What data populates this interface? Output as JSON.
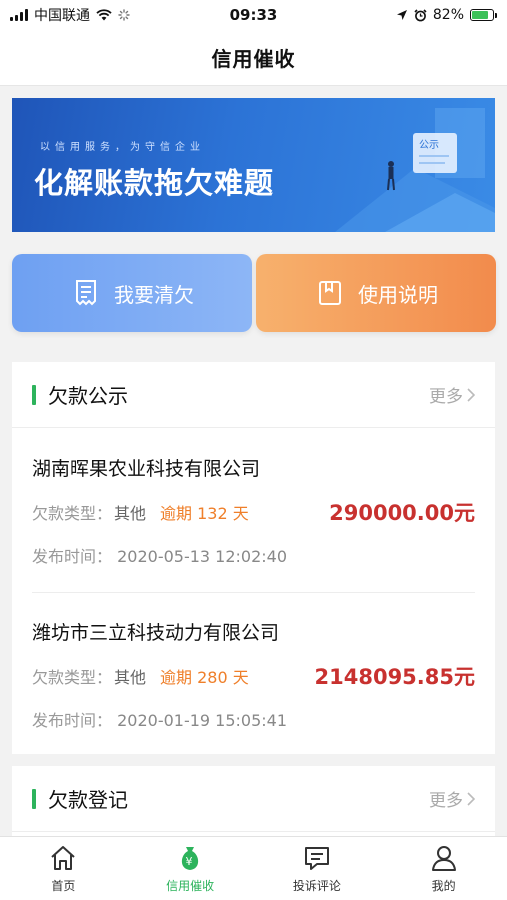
{
  "status_bar": {
    "carrier": "中国联通",
    "time": "09:33",
    "battery": "82%",
    "battery_level": 0.82
  },
  "nav": {
    "title": "信用催收"
  },
  "banner": {
    "subtitle": "以信用服务，为守信企业",
    "title": "化解账款拖欠难题",
    "sign_text": "公示"
  },
  "actions": {
    "clear_debt": "我要清欠",
    "guide": "使用说明"
  },
  "debt_notice": {
    "title": "欠款公示",
    "more": "更多",
    "items": [
      {
        "company": "湖南晖果农业科技有限公司",
        "type_label": "欠款类型：",
        "type": "其他",
        "overdue": "逾期 132 天",
        "amount": "290000.00元",
        "time_label": "发布时间：",
        "time": "2020-05-13 12:02:40"
      },
      {
        "company": "潍坊市三立科技动力有限公司",
        "type_label": "欠款类型：",
        "type": "其他",
        "overdue": "逾期 280 天",
        "amount": "2148095.85元",
        "time_label": "发布时间：",
        "time": "2020-01-19 15:05:41"
      }
    ]
  },
  "debt_register": {
    "title": "欠款登记",
    "more": "更多"
  },
  "tabs": [
    {
      "label": "首页",
      "icon": "home-icon"
    },
    {
      "label": "信用催收",
      "icon": "money-bag-icon",
      "active": true
    },
    {
      "label": "投诉评论",
      "icon": "comment-icon"
    },
    {
      "label": "我的",
      "icon": "user-icon"
    }
  ],
  "colors": {
    "accent_green": "#2db35c",
    "amount_red": "#c8312f",
    "overdue_orange": "#ef7f2a",
    "banner_blue": "#2c73d6"
  }
}
